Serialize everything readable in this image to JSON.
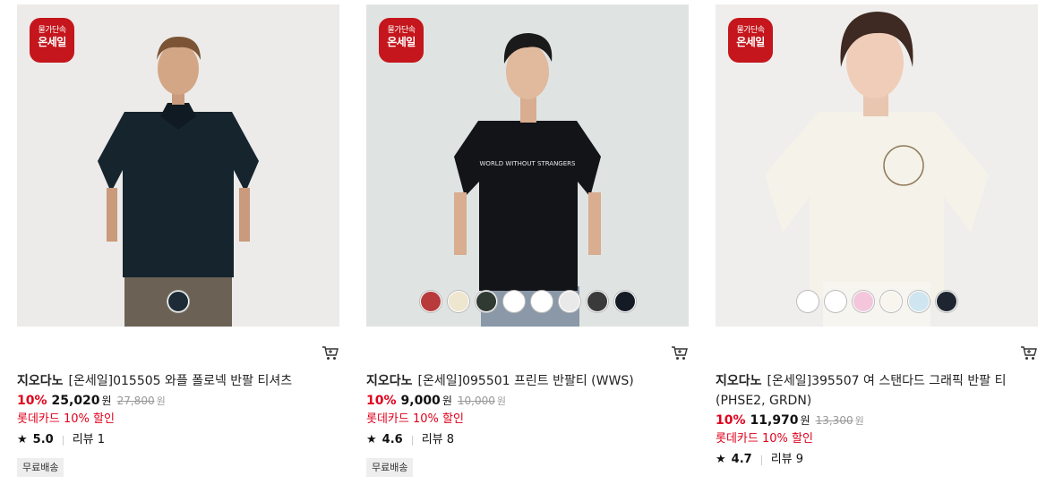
{
  "badge": {
    "line1": "물가단속",
    "line2": "온세일"
  },
  "products": [
    {
      "brand": "지오다노",
      "name": "[온세일]015505 와플 폴로넥 반팔 티셔츠",
      "discount": "10%",
      "price": "25,020",
      "currency": "원",
      "original_price": "27,800",
      "card_promo": "롯데카드 10% 할인",
      "rating": "5.0",
      "reviews": "리뷰 1",
      "shipping_tag": "무료배송",
      "swatches": [
        "#1d2b36"
      ]
    },
    {
      "brand": "지오다노",
      "name": "[온세일]095501 프린트 반팔티 (WWS)",
      "discount": "10%",
      "price": "9,000",
      "currency": "원",
      "original_price": "10,000",
      "card_promo": "롯데카드 10% 할인",
      "rating": "4.6",
      "reviews": "리뷰 8",
      "shipping_tag": "무료배송",
      "swatches": [
        "#b83a3a",
        "#efe6cf",
        "#2f3a33",
        "#ffffff",
        "#ffffff",
        "#e9e9e9",
        "#3a3a3a",
        "#151b24"
      ]
    },
    {
      "brand": "지오다노",
      "name": "[온세일]395507 여 스탠다드 그래픽 반팔 티 (PHSE2, GRDN)",
      "discount": "10%",
      "price": "11,970",
      "currency": "원",
      "original_price": "13,300",
      "card_promo": "롯데카드 10% 할인",
      "rating": "4.7",
      "reviews": "리뷰 9",
      "shipping_tag": "",
      "swatches": [
        "#ffffff",
        "#ffffff",
        "#f3c6dc",
        "#f7f5ee",
        "#cfe6f0",
        "#1e2530"
      ]
    }
  ],
  "colors": {
    "accent": "#e0001b",
    "badge": "#c4161c"
  }
}
